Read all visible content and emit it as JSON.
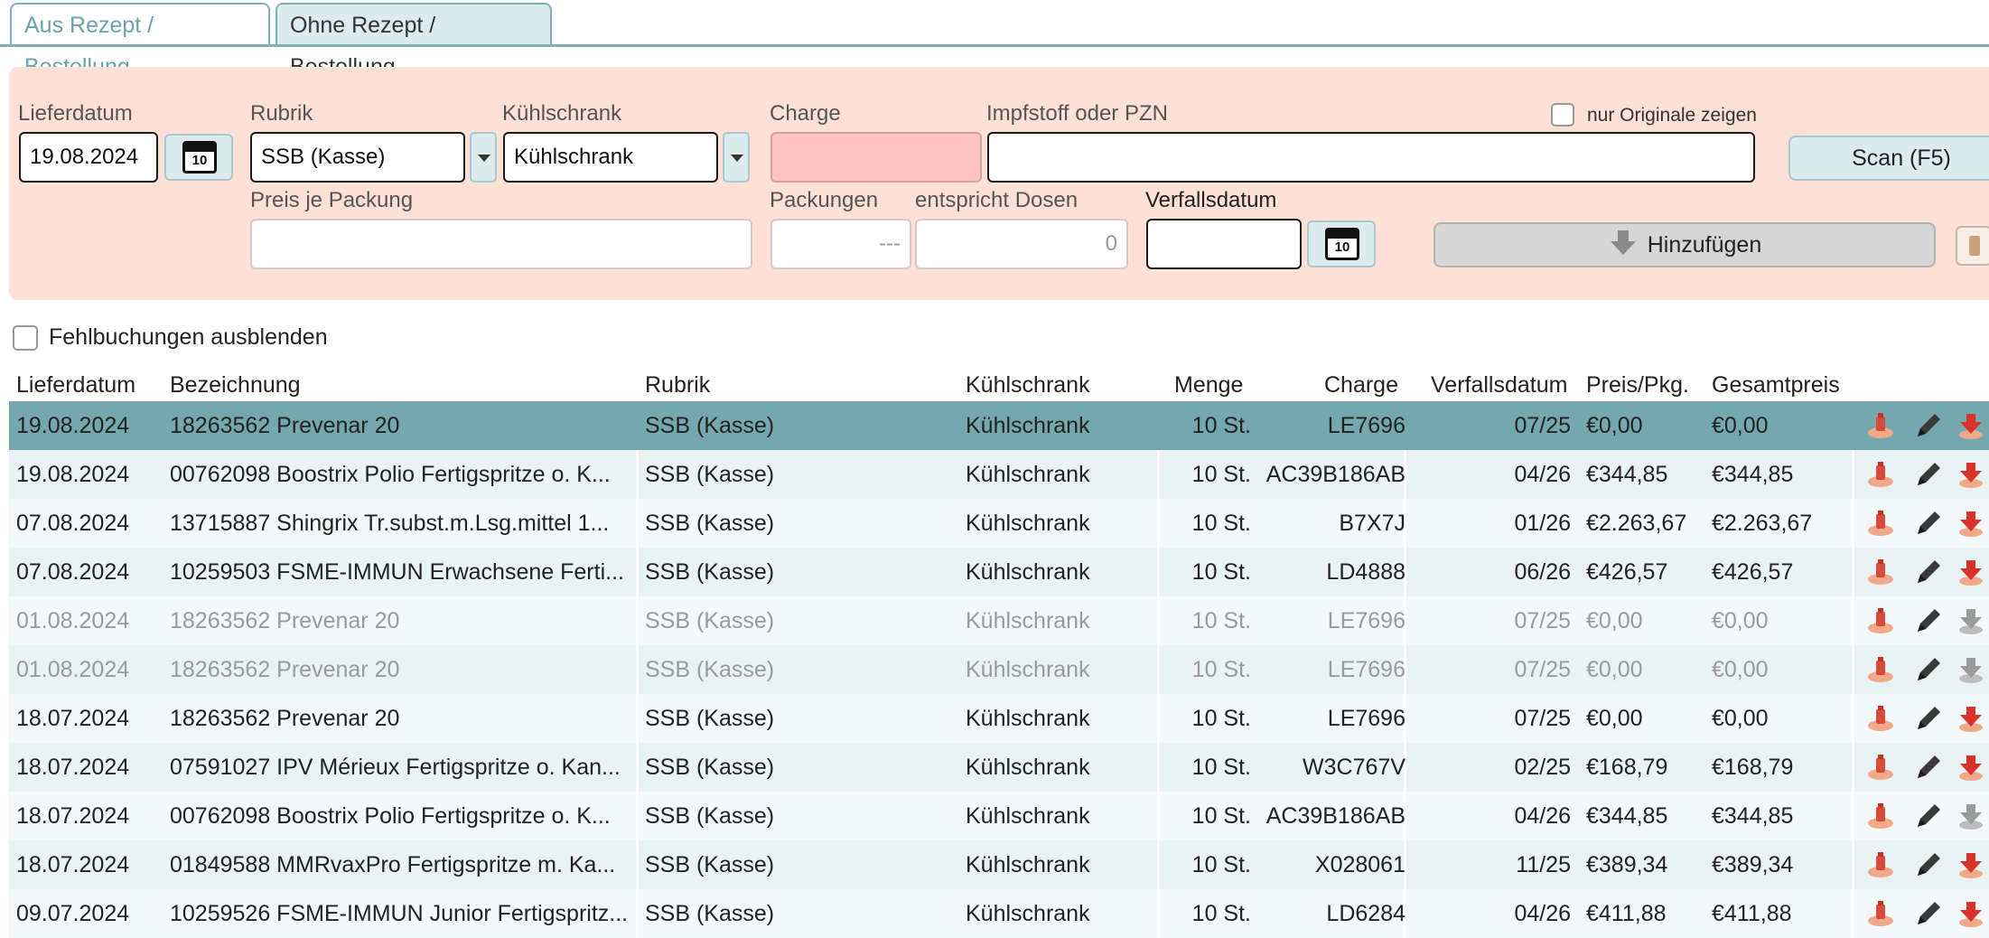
{
  "tabs": [
    {
      "label": "Aus Rezept / Bestellung"
    },
    {
      "label": "Ohne Rezept / Bestellung"
    }
  ],
  "form": {
    "lieferdatum_label": "Lieferdatum",
    "lieferdatum_value": "19.08.2024",
    "rubrik_label": "Rubrik",
    "rubrik_value": "SSB (Kasse)",
    "kuehlschrank_label": "Kühlschrank",
    "kuehlschrank_value": "Kühlschrank",
    "charge_label": "Charge",
    "charge_value": "",
    "impfstoff_label": "Impfstoff oder PZN",
    "impfstoff_value": "",
    "nur_originale_label": "nur Originale zeigen",
    "scan_label": "Scan (F5)",
    "preis_label": "Preis je Packung",
    "preis_value": "",
    "packungen_label": "Packungen",
    "packungen_placeholder": "---",
    "dosen_label": "entspricht Dosen",
    "dosen_value": "0",
    "verfallsdatum_label": "Verfallsdatum",
    "verfallsdatum_value": "",
    "hinzufuegen_label": "Hinzufügen",
    "calendar_day": "10"
  },
  "filter": {
    "fehlbuchungen_label": "Fehlbuchungen ausblenden"
  },
  "table": {
    "headers": {
      "lieferdatum": "Lieferdatum",
      "bezeichnung": "Bezeichnung",
      "rubrik": "Rubrik",
      "kuehlschrank": "Kühlschrank",
      "menge": "Menge",
      "charge": "Charge",
      "verfallsdatum": "Verfallsdatum",
      "preis": "Preis/Pkg.",
      "gesamtpreis": "Gesamtpreis"
    },
    "rows": [
      {
        "lieferdatum": "19.08.2024",
        "bezeichnung": "18263562 Prevenar 20",
        "rubrik": "SSB (Kasse)",
        "kuehlschrank": "Kühlschrank",
        "menge": "10 St.",
        "charge": "LE7696",
        "verfall": "07/25",
        "preis": "€0,00",
        "gesamt": "€0,00",
        "state": "selected"
      },
      {
        "lieferdatum": "19.08.2024",
        "bezeichnung": "00762098 Boostrix Polio Fertigspritze o. K...",
        "rubrik": "SSB (Kasse)",
        "kuehlschrank": "Kühlschrank",
        "menge": "10 St.",
        "charge": "AC39B186AB",
        "verfall": "04/26",
        "preis": "€344,85",
        "gesamt": "€344,85",
        "state": "normal"
      },
      {
        "lieferdatum": "07.08.2024",
        "bezeichnung": "13715887 Shingrix  Tr.subst.m.Lsg.mittel 1...",
        "rubrik": "SSB (Kasse)",
        "kuehlschrank": "Kühlschrank",
        "menge": "10 St.",
        "charge": "B7X7J",
        "verfall": "01/26",
        "preis": "€2.263,67",
        "gesamt": "€2.263,67",
        "state": "normal"
      },
      {
        "lieferdatum": "07.08.2024",
        "bezeichnung": "10259503 FSME-IMMUN Erwachsene Ferti...",
        "rubrik": "SSB (Kasse)",
        "kuehlschrank": "Kühlschrank",
        "menge": "10 St.",
        "charge": "LD4888",
        "verfall": "06/26",
        "preis": "€426,57",
        "gesamt": "€426,57",
        "state": "normal"
      },
      {
        "lieferdatum": "01.08.2024",
        "bezeichnung": "18263562 Prevenar 20",
        "rubrik": "SSB (Kasse)",
        "kuehlschrank": "Kühlschrank",
        "menge": "10 St.",
        "charge": "LE7696",
        "verfall": "07/25",
        "preis": "€0,00",
        "gesamt": "€0,00",
        "state": "faded"
      },
      {
        "lieferdatum": "01.08.2024",
        "bezeichnung": "18263562 Prevenar 20",
        "rubrik": "SSB (Kasse)",
        "kuehlschrank": "Kühlschrank",
        "menge": "10 St.",
        "charge": "LE7696",
        "verfall": "07/25",
        "preis": "€0,00",
        "gesamt": "€0,00",
        "state": "faded"
      },
      {
        "lieferdatum": "18.07.2024",
        "bezeichnung": "18263562 Prevenar 20",
        "rubrik": "SSB (Kasse)",
        "kuehlschrank": "Kühlschrank",
        "menge": "10 St.",
        "charge": "LE7696",
        "verfall": "07/25",
        "preis": "€0,00",
        "gesamt": "€0,00",
        "state": "normal"
      },
      {
        "lieferdatum": "18.07.2024",
        "bezeichnung": "07591027 IPV Mérieux Fertigspritze o. Kan...",
        "rubrik": "SSB (Kasse)",
        "kuehlschrank": "Kühlschrank",
        "menge": "10 St.",
        "charge": "W3C767V",
        "verfall": "02/25",
        "preis": "€168,79",
        "gesamt": "€168,79",
        "state": "normal"
      },
      {
        "lieferdatum": "18.07.2024",
        "bezeichnung": "00762098 Boostrix Polio Fertigspritze o. K...",
        "rubrik": "SSB (Kasse)",
        "kuehlschrank": "Kühlschrank",
        "menge": "10 St.",
        "charge": "AC39B186AB",
        "verfall": "04/26",
        "preis": "€344,85",
        "gesamt": "€344,85",
        "state": "normal",
        "grey_third_icon": true
      },
      {
        "lieferdatum": "18.07.2024",
        "bezeichnung": "01849588 MMRvaxPro Fertigspritze m. Ka...",
        "rubrik": "SSB (Kasse)",
        "kuehlschrank": "Kühlschrank",
        "menge": "10 St.",
        "charge": "X028061",
        "verfall": "11/25",
        "preis": "€389,34",
        "gesamt": "€389,34",
        "state": "normal"
      },
      {
        "lieferdatum": "09.07.2024",
        "bezeichnung": "10259526 FSME-IMMUN Junior Fertigspritz...",
        "rubrik": "SSB (Kasse)",
        "kuehlschrank": "Kühlschrank",
        "menge": "10 St.",
        "charge": "LD6284",
        "verfall": "04/26",
        "preis": "€411,88",
        "gesamt": "€411,88",
        "state": "normal"
      }
    ]
  },
  "colors": {
    "tab_border": "#7fb0b8",
    "panel_bg": "#fde0d6",
    "selected_row": "#75a8ae",
    "charge_error": "#fec4c4"
  }
}
